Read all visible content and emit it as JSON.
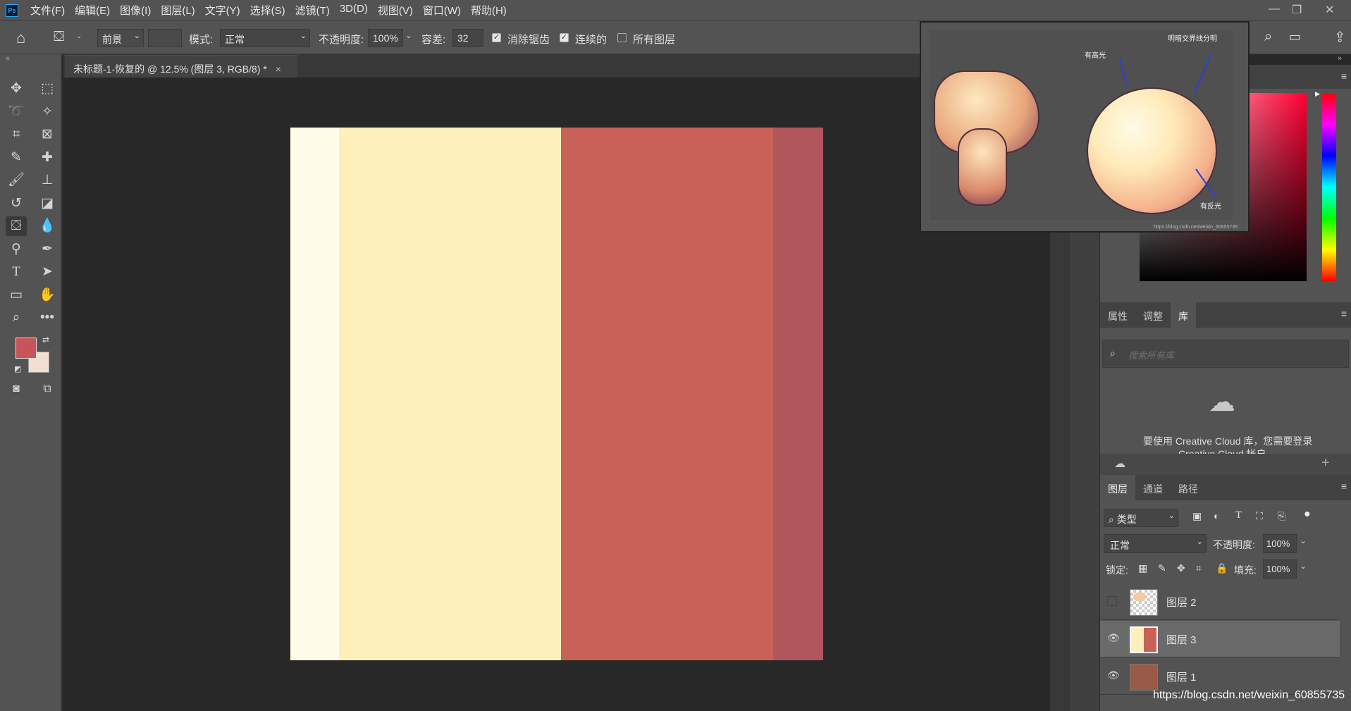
{
  "app": {
    "logo": "Ps",
    "menus": [
      "文件(F)",
      "编辑(E)",
      "图像(I)",
      "图层(L)",
      "文字(Y)",
      "选择(S)",
      "滤镜(T)",
      "3D(D)",
      "视图(V)",
      "窗口(W)",
      "帮助(H)"
    ]
  },
  "options": {
    "fill_source": "前景",
    "mode_label": "模式:",
    "mode_value": "正常",
    "opacity_label": "不透明度:",
    "opacity_value": "100%",
    "tolerance_label": "容差:",
    "tolerance_value": "32",
    "antialias_label": "消除锯齿",
    "antialias_checked": true,
    "contiguous_label": "连续的",
    "contiguous_checked": true,
    "all_layers_label": "所有图层",
    "all_layers_checked": false
  },
  "document": {
    "tab_title": "未标题-1-恢复的 @ 12.5% (图层 3, RGB/8) *",
    "close_glyph": "×",
    "canvas_strips": [
      {
        "color": "#fffce8",
        "fraction": 0.091
      },
      {
        "color": "#fdf0bd",
        "fraction": 0.417
      },
      {
        "color": "#c86158",
        "fraction": 0.398
      },
      {
        "color": "#b2565d",
        "fraction": 0.094
      }
    ]
  },
  "colors": {
    "foreground": "#c8545b",
    "background": "#f2dfd1"
  },
  "reference_image": {
    "note_highlight": "有高光",
    "note_terminator": "明暗交界线分明",
    "note_reflect": "有反光",
    "watermark": "https://blog.csdn.net/weixin_60855735"
  },
  "props_panel": {
    "tabs": [
      "属性",
      "调整",
      "库"
    ],
    "active_tab": "库",
    "search_placeholder": "搜索所有库",
    "cc_message": "要使用 Creative Cloud 库，您需要登录",
    "cc_message_2": "Creative Cloud 帐户"
  },
  "layers_panel": {
    "tabs": [
      "图层",
      "通道",
      "路径"
    ],
    "filter_label": "类型",
    "blend_mode": "正常",
    "opacity_label": "不透明度:",
    "opacity_value": "100%",
    "lock_label": "锁定:",
    "fill_label": "填充:",
    "fill_value": "100%",
    "layers": [
      {
        "name": "图层 2",
        "visible": false,
        "selected": false
      },
      {
        "name": "图层 3",
        "visible": true,
        "selected": true
      },
      {
        "name": "图层 1",
        "visible": true,
        "selected": false
      }
    ]
  },
  "footer_watermark": "https://blog.csdn.net/weixin_60855735"
}
